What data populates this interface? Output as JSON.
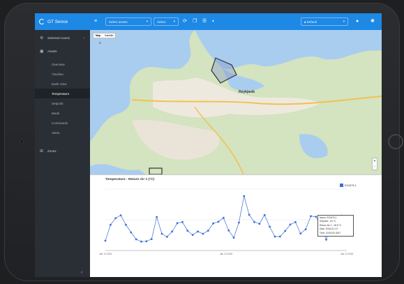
{
  "app": {
    "title": "GT Sence"
  },
  "toolbar": {
    "menu_icon": "hamburger-icon",
    "assets_placeholder": "Select assets",
    "range_value": "Select",
    "user_label": "Default"
  },
  "sidebar": {
    "items": [
      {
        "label": "Selected Assets",
        "icon": "gear-icon"
      },
      {
        "label": "Assets",
        "icon": "asset-icon"
      }
    ],
    "sub_items": [
      "Overview",
      "Timeline",
      "Dash View",
      "Temperature",
      "Setpoint",
      "Mode",
      "Commands",
      "Alerts"
    ],
    "tail_items": [
      {
        "label": "Zones",
        "icon": "zones-icon"
      }
    ],
    "collapse_icon": "chevron-left-icon"
  },
  "map": {
    "toggle": [
      "Map",
      "Satellite"
    ],
    "city_label": "Reykjavík",
    "zoom_in": "+",
    "zoom_out": "-"
  },
  "chart_data": {
    "type": "line",
    "title": "Temperature - Return Air 1 (°C)",
    "legend": "ECM75-1",
    "series_color": "#3b6fd6",
    "x_tick_labels": [
      "Jan 12 2016",
      "Jan 13 2016",
      "Jan 14 2016"
    ],
    "y_tick_labels": [
      "",
      "",
      ""
    ],
    "values": [
      3.5,
      9.2,
      11.6,
      12.6,
      9.2,
      6.5,
      4.0,
      3.2,
      3.3,
      4.1,
      12.0,
      6.0,
      4.9,
      6.8,
      9.8,
      10.2,
      7.1,
      5.6,
      6.8,
      6.0,
      7.1,
      9.7,
      10.3,
      11.7,
      7.2,
      4.6,
      10.0,
      19.5,
      12.8,
      10.2,
      9.6,
      12.7,
      8.5,
      5.0,
      5.0,
      7.0,
      9.3,
      10.2,
      6.1,
      7.6,
      12.3,
      12.1,
      8.7,
      3.9,
      11.2,
      9.1,
      12.5,
      9.1
    ],
    "ylim": [
      0,
      22
    ],
    "tooltip": {
      "name": "Name: ECM75-1",
      "setpoint": "Setpoint: -20 °C",
      "return_air": "Return Air 1: -18.8 °C",
      "date": "Date: 2016-01-13",
      "time": "Time: 03:00:00 GMT"
    }
  }
}
